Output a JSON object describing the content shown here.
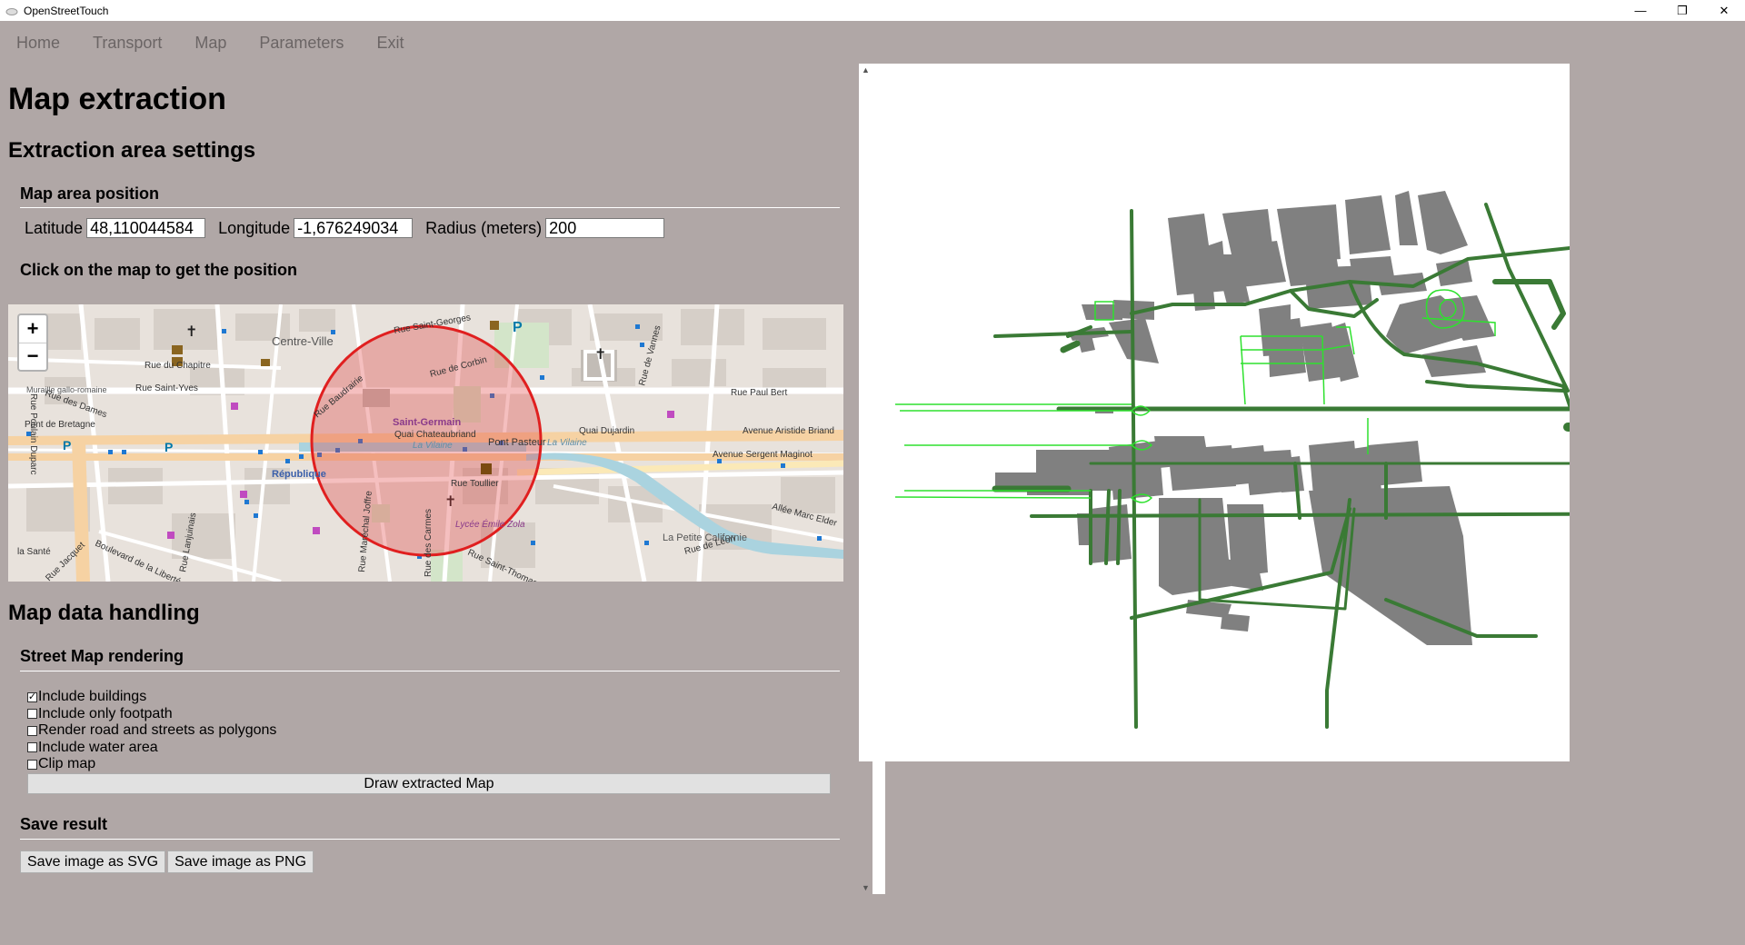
{
  "window": {
    "title": "OpenStreetTouch",
    "controls": {
      "minimize": "—",
      "restore": "❐",
      "close": "✕"
    }
  },
  "menu": [
    "Home",
    "Transport",
    "Map",
    "Parameters",
    "Exit"
  ],
  "page": {
    "title": "Map extraction",
    "extraction_section": "Extraction area settings",
    "position_section": "Map area position",
    "latitude_label": "Latitude",
    "latitude_value": "48,110044584",
    "longitude_label": "Longitude",
    "longitude_value": "-1,676249034",
    "radius_label": "Radius (meters)",
    "radius_value": "200",
    "click_hint": "Click on the map to get the position",
    "data_section": "Map data handling",
    "rendering_section": "Street Map rendering",
    "save_section": "Save result"
  },
  "map": {
    "zoom_in": "+",
    "zoom_out": "−",
    "labels": {
      "centre_ville": "Centre-Ville",
      "saint_germain": "Saint-Germain",
      "republique": "République",
      "rue_saint_georges": "Rue Saint-Georges",
      "rue_de_corbin": "Rue de Corbin",
      "rue_baudrairie": "Rue Baudrairie",
      "rue_du_chapitre": "Rue du Chapitre",
      "rue_des_dames": "Rue des Dames",
      "rue_saint_yves": "Rue Saint-Yves",
      "muraille": "Muraille gallo-romaine",
      "pont_de_bretagne": "Pont de Bretagne",
      "quai_chateaubriand": "Quai Chateaubriand",
      "la_vilaine_1": "La Vilaine",
      "la_vilaine_2": "La Vilaine",
      "pont_pasteur": "Pont Pasteur",
      "quai_dujardin": "Quai Dujardin",
      "avenue_aristide_briand": "Avenue Aristide Briand",
      "avenue_sergent_maginot": "Avenue Sergent Maginot",
      "rue_paul_bert": "Rue Paul Bert",
      "rue_toullier": "Rue Toullier",
      "lycee_emile_zola": "Lycée Émile Zola",
      "allee_marc_elder": "Allée Marc Elder",
      "la_petite_californie": "La Petite Californie",
      "rue_de_leon": "Rue de Léon",
      "boulevard_liberte": "Boulevard de la Liberté",
      "rue_lanjuinais": "Rue Lanjuinais",
      "rue_marechal_joffre": "Rue Maréchal Joffre",
      "rue_des_carmes": "Rue des Carmes",
      "rue_saint_thomas": "Rue Saint-Thomas",
      "la_sante": "la Santé",
      "rue_de_vannes": "Rue de Vannes",
      "rue_jacquet": "Rue Jacquet",
      "rue_poulain": "Rue Poulain Duparc"
    },
    "selection_circle_color": "#e01f1f"
  },
  "options": [
    {
      "label": "Include buildings",
      "checked": true
    },
    {
      "label": "Include only footpath",
      "checked": false
    },
    {
      "label": "Render road and streets as polygons",
      "checked": false
    },
    {
      "label": "Include water area",
      "checked": false
    },
    {
      "label": "Clip map",
      "checked": false
    }
  ],
  "buttons": {
    "draw": "Draw extracted Map",
    "save_svg": "Save image as SVG",
    "save_png": "Save image as PNG"
  },
  "colors": {
    "background": "#b0a7a6",
    "road_dark": "#3a7a35",
    "path_light": "#22dd22",
    "building": "#808080"
  }
}
